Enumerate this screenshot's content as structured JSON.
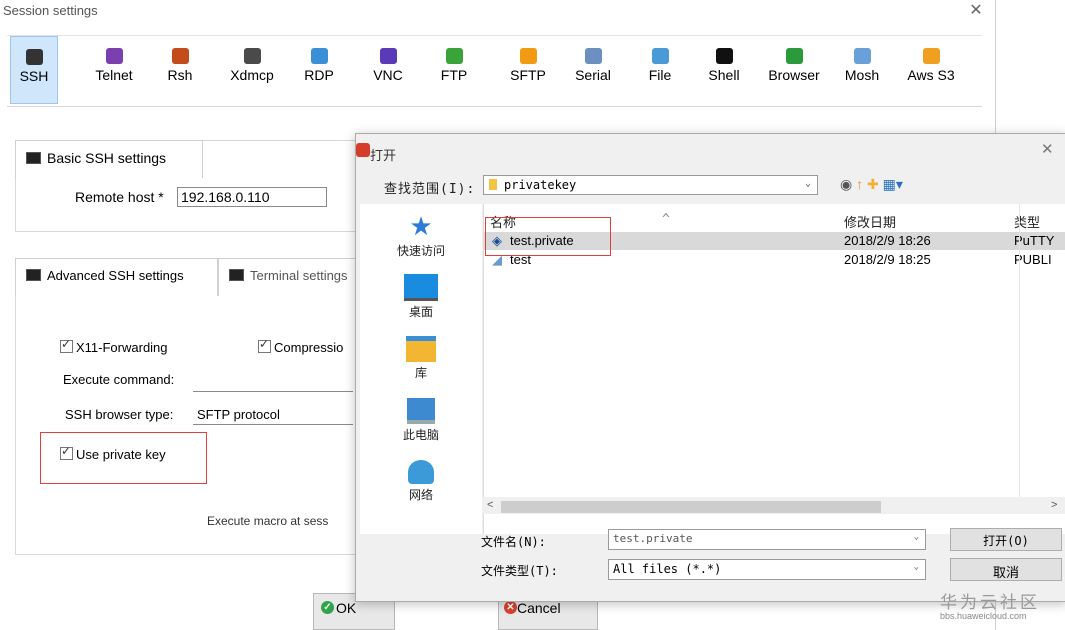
{
  "session": {
    "title": "Session settings",
    "close": "✕",
    "protocols": [
      {
        "label": "SSH",
        "color": "#333333"
      },
      {
        "label": "Telnet",
        "color": "#7b3fb0"
      },
      {
        "label": "Rsh",
        "color": "#c44b1a"
      },
      {
        "label": "Xdmcp",
        "color": "#4a4a4a"
      },
      {
        "label": "RDP",
        "color": "#3a8fd6"
      },
      {
        "label": "VNC",
        "color": "#5b3ab8"
      },
      {
        "label": "FTP",
        "color": "#3aa33a"
      },
      {
        "label": "SFTP",
        "color": "#f19a12"
      },
      {
        "label": "Serial",
        "color": "#6b8fbf"
      },
      {
        "label": "File",
        "color": "#4a9ad8"
      },
      {
        "label": "Shell",
        "color": "#111111"
      },
      {
        "label": "Browser",
        "color": "#2a9a3a"
      },
      {
        "label": "Mosh",
        "color": "#6aa0d8"
      },
      {
        "label": "Aws S3",
        "color": "#f0a020"
      }
    ],
    "basic_tab": "Basic SSH settings",
    "remote_host_label": "Remote host *",
    "remote_host_value": "192.168.0.110",
    "advanced_tab": "Advanced SSH settings",
    "terminal_tab": "Terminal settings",
    "x11_label": "X11-Forwarding",
    "compression_label": "Compressio",
    "execute_label": "Execute command:",
    "browser_type_label": "SSH browser type:",
    "browser_type_value": "SFTP protocol",
    "private_key_label": "Use private key",
    "macro_label": "Execute macro at sess",
    "ok": "OK",
    "cancel": "Cancel"
  },
  "dialog": {
    "title": "打开",
    "close": "✕",
    "lookin_label": "查找范围(I):",
    "lookin_value": "privatekey",
    "places": [
      {
        "label": "快速访问",
        "color": "#2f7bd8"
      },
      {
        "label": "桌面",
        "color": "#1a8ce0"
      },
      {
        "label": "库",
        "color": "#f2b632"
      },
      {
        "label": "此电脑",
        "color": "#3d8ad0"
      },
      {
        "label": "网络",
        "color": "#3d9ad8"
      }
    ],
    "columns": {
      "name": "名称",
      "date": "修改日期",
      "type": "类型"
    },
    "files": [
      {
        "name": "test.private",
        "date": "2018/2/9 18:26",
        "type": "PuTTY"
      },
      {
        "name": "test",
        "date": "2018/2/9 18:25",
        "type": "PUBLI"
      }
    ],
    "filename_label": "文件名(N):",
    "filename_value": "test.private",
    "filetype_label": "文件类型(T):",
    "filetype_value": "All files (*.*)",
    "open_button": "打开(O)",
    "cancel_button": "取消"
  },
  "watermark": {
    "line1": "华为云社区",
    "line2": "bbs.huaweicloud.com"
  }
}
